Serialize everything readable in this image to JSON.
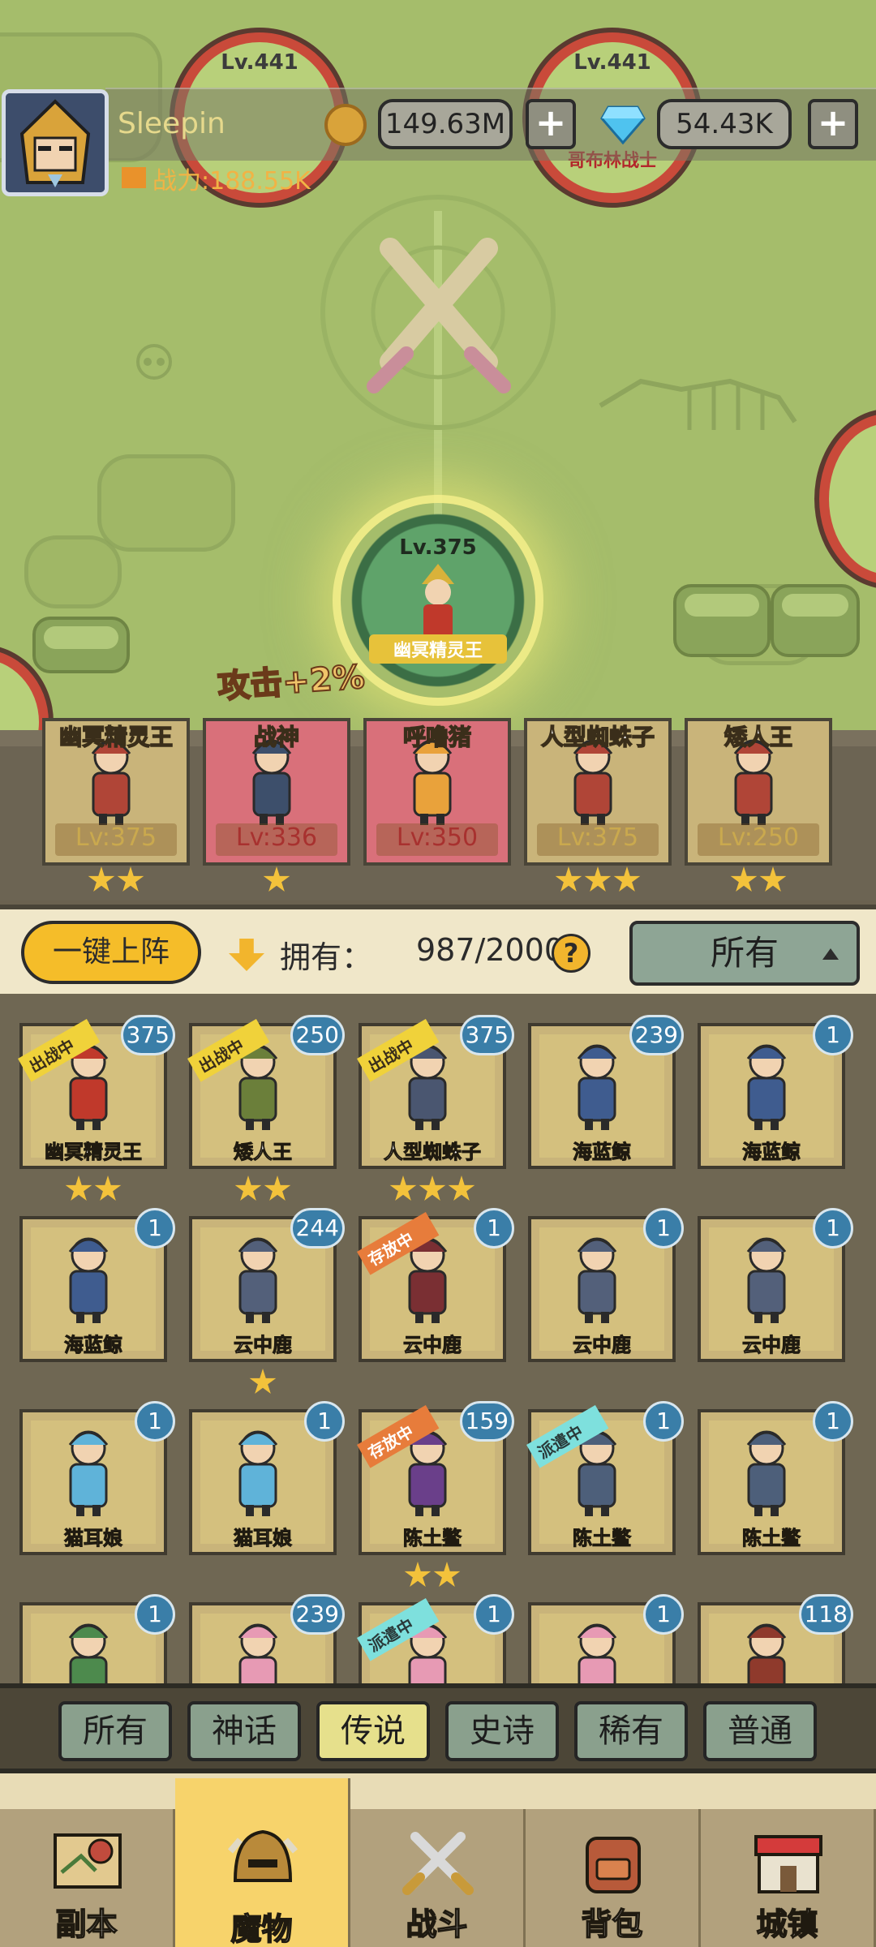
{
  "hud": {
    "player_name": "Sleepin",
    "gold": "149.63M",
    "gems": "54.43K",
    "power_label": "战力:188.55K",
    "plus": "+"
  },
  "map": {
    "enemies": [
      {
        "level": "Lv.441",
        "name": ""
      },
      {
        "level": "Lv.441",
        "name": "哥布林战士"
      }
    ],
    "current_node": {
      "level": "Lv.375",
      "name": "幽冥精灵王"
    },
    "attack_bonus": "攻击+2%"
  },
  "team": [
    {
      "name": "幽冥精灵王",
      "level": "Lv:375",
      "stars": 2,
      "bg": "#c9b47a"
    },
    {
      "name": "战神",
      "level": "Lv:336",
      "stars": 1,
      "bg": "#d9707a"
    },
    {
      "name": "呼噜猪",
      "level": "Lv:350",
      "stars": 0,
      "bg": "#d9707a"
    },
    {
      "name": "人型蜘蛛子",
      "level": "Lv:375",
      "stars": 3,
      "bg": "#c9b47a"
    },
    {
      "name": "矮人王",
      "level": "Lv:250",
      "stars": 2,
      "bg": "#c9b47a"
    }
  ],
  "roster_header": {
    "deploy_all": "一键上阵",
    "owned_label": "拥有：",
    "owned_count": "987/2000",
    "help": "?",
    "filter": "所有"
  },
  "roster": [
    {
      "name": "幽冥精灵王",
      "level": "375",
      "status": "出战中",
      "status_type": "fighting",
      "stars": 2,
      "color": "#c0392b"
    },
    {
      "name": "矮人王",
      "level": "250",
      "status": "出战中",
      "status_type": "fighting",
      "stars": 2,
      "color": "#6b7f3a"
    },
    {
      "name": "人型蜘蛛子",
      "level": "375",
      "status": "出战中",
      "status_type": "fighting",
      "stars": 3,
      "color": "#4a5670"
    },
    {
      "name": "海蓝鲸",
      "level": "239",
      "status": "",
      "status_type": "",
      "stars": 0,
      "color": "#3f5c8f"
    },
    {
      "name": "海蓝鲸",
      "level": "1",
      "status": "",
      "status_type": "",
      "stars": 0,
      "color": "#3f5c8f"
    },
    {
      "name": "海蓝鲸",
      "level": "1",
      "status": "",
      "status_type": "",
      "stars": 0,
      "color": "#3f5c8f"
    },
    {
      "name": "云中鹿",
      "level": "244",
      "status": "",
      "status_type": "",
      "stars": 1,
      "color": "#53607a"
    },
    {
      "name": "云中鹿",
      "level": "1",
      "status": "存放中",
      "status_type": "stored",
      "stars": 0,
      "color": "#7a2f33"
    },
    {
      "name": "云中鹿",
      "level": "1",
      "status": "",
      "status_type": "",
      "stars": 0,
      "color": "#53607a"
    },
    {
      "name": "云中鹿",
      "level": "1",
      "status": "",
      "status_type": "",
      "stars": 0,
      "color": "#53607a"
    },
    {
      "name": "猫耳娘",
      "level": "1",
      "status": "",
      "status_type": "",
      "stars": 0,
      "color": "#5fb3d9"
    },
    {
      "name": "猫耳娘",
      "level": "1",
      "status": "",
      "status_type": "",
      "stars": 0,
      "color": "#5fb3d9"
    },
    {
      "name": "陈土鳖",
      "level": "159",
      "status": "存放中",
      "status_type": "stored",
      "stars": 2,
      "color": "#6a3f8a"
    },
    {
      "name": "陈土鳖",
      "level": "1",
      "status": "派遣中",
      "status_type": "dispatched",
      "stars": 0,
      "color": "#4d5f7a"
    },
    {
      "name": "陈土鳖",
      "level": "1",
      "status": "",
      "status_type": "",
      "stars": 0,
      "color": "#4d5f7a"
    },
    {
      "name": "",
      "level": "1",
      "status": "",
      "status_type": "",
      "stars": 0,
      "color": "#4d8a4d"
    },
    {
      "name": "",
      "level": "239",
      "status": "",
      "status_type": "",
      "stars": 0,
      "color": "#e79ab4"
    },
    {
      "name": "",
      "level": "1",
      "status": "派遣中",
      "status_type": "dispatched",
      "stars": 0,
      "color": "#e79ab4"
    },
    {
      "name": "",
      "level": "1",
      "status": "",
      "status_type": "",
      "stars": 0,
      "color": "#e79ab4"
    },
    {
      "name": "",
      "level": "118",
      "status": "",
      "status_type": "",
      "stars": 0,
      "color": "#8f3a2c"
    }
  ],
  "rarity_tabs": [
    {
      "label": "所有",
      "active": false
    },
    {
      "label": "神话",
      "active": false
    },
    {
      "label": "传说",
      "active": true
    },
    {
      "label": "史诗",
      "active": false
    },
    {
      "label": "稀有",
      "active": false
    },
    {
      "label": "普通",
      "active": false
    }
  ],
  "nav": [
    {
      "label": "副本",
      "icon": "map-icon",
      "active": false
    },
    {
      "label": "魔物",
      "icon": "helmet-icon",
      "active": true
    },
    {
      "label": "战斗",
      "icon": "swords-icon",
      "active": false
    },
    {
      "label": "背包",
      "icon": "backpack-icon",
      "active": false
    },
    {
      "label": "城镇",
      "icon": "shop-icon",
      "active": false
    }
  ],
  "colors": {
    "accent": "#f5bd29",
    "map_green": "#a5bd6b",
    "panel": "#6f6753",
    "level_badge": "#3a7ea8"
  }
}
